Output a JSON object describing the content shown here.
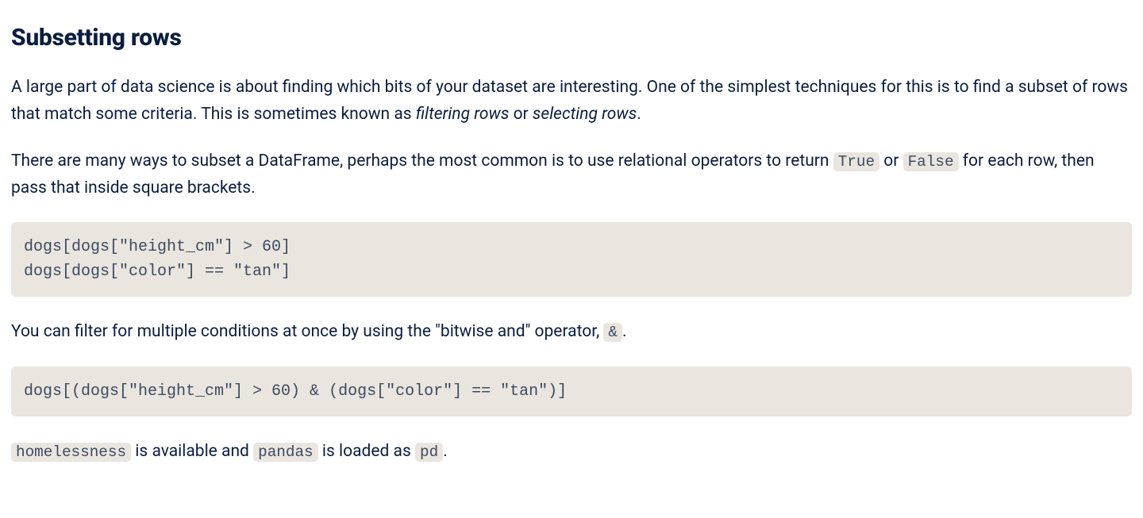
{
  "heading": "Subsetting rows",
  "p1": {
    "a": "A large part of data science is about finding which bits of your dataset are interesting. One of the simplest techniques for this is to find a subset of rows that match some criteria. This is sometimes known as ",
    "em1": "filtering rows",
    "b": " or ",
    "em2": "selecting rows",
    "c": "."
  },
  "p2": {
    "a": "There are many ways to subset a DataFrame, perhaps the most common is to use relational operators to return ",
    "code1": "True",
    "b": " or ",
    "code2": "False",
    "c": " for each row, then pass that inside square brackets."
  },
  "codeblock1": "dogs[dogs[\"height_cm\"] > 60]\ndogs[dogs[\"color\"] == \"tan\"]",
  "p3": {
    "a": "You can filter for multiple conditions at once by using the \"bitwise and\" operator, ",
    "code1": "&",
    "b": "."
  },
  "codeblock2": "dogs[(dogs[\"height_cm\"] > 60) & (dogs[\"color\"] == \"tan\")]",
  "p4": {
    "code1": "homelessness",
    "a": " is available and ",
    "code2": "pandas",
    "b": " is loaded as ",
    "code3": "pd",
    "c": "."
  }
}
